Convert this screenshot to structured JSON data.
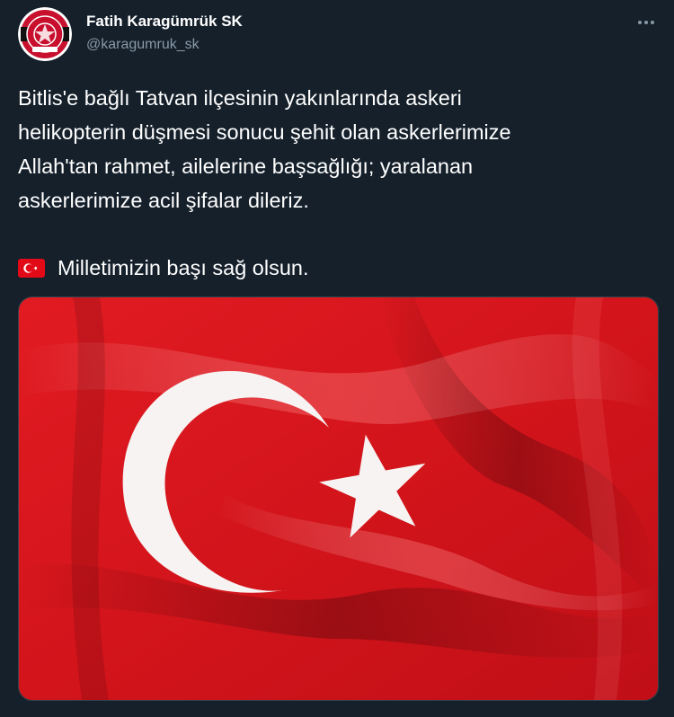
{
  "author": {
    "display_name": "Fatih Karagümrük SK",
    "handle": "@karagumruk_sk",
    "avatar_icon": "club-crest-icon"
  },
  "menu": {
    "icon": "more-horizontal-icon"
  },
  "tweet": {
    "lines": [
      "Bitlis'e bağlı Tatvan ilçesinin yakınlarında askeri",
      "helikopterin düşmesi sonucu şehit olan askerlerimize",
      "Allah'tan rahmet, ailelerine başsağlığı; yaralanan",
      "askerlerimize acil şifalar dileriz."
    ],
    "closing_line": "Milletimizin başı sağ olsun.",
    "closing_icon": "turkey-flag-emoji-icon"
  },
  "media": {
    "icon": "turkish-flag-photo",
    "colors": {
      "flag_red": "#d8141c",
      "crescent_star": "#f6f3f2"
    }
  },
  "colors": {
    "background": "#15202b",
    "text_primary": "#ffffff",
    "text_secondary": "#8899a6",
    "border": "#38444d"
  }
}
